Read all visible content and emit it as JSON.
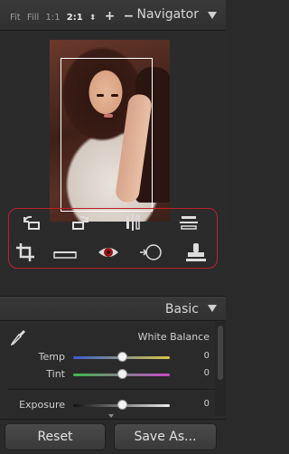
{
  "navigator": {
    "zoom_options": [
      "Fit",
      "Fill",
      "1:1"
    ],
    "zoom_active": "2:1",
    "zoom_stepper": "⬍",
    "zoom_in": "+",
    "zoom_out": "−",
    "title": "Navigator"
  },
  "tools": {
    "icons": [
      "rotate-left-icon",
      "rotate-right-icon",
      "flip-horizontal-icon",
      "flip-vertical-icon",
      "crop-icon",
      "straighten-icon",
      "red-eye-icon",
      "spot-removal-icon",
      "clone-stamp-icon"
    ]
  },
  "basic": {
    "title": "Basic",
    "white_balance_label": "White Balance",
    "sliders": [
      {
        "label": "Temp",
        "value": "0",
        "position": 0.5
      },
      {
        "label": "Tint",
        "value": "0",
        "position": 0.5
      },
      {
        "label": "Exposure",
        "value": "0",
        "position": 0.5
      }
    ]
  },
  "footer": {
    "reset_label": "Reset",
    "save_label": "Save As..."
  },
  "colors": {
    "accent_red": "#c0202a",
    "temp_start": "#3a5bd0",
    "temp_end": "#d8c845",
    "tint_start": "#3fb84a",
    "tint_end": "#c84ac8"
  }
}
